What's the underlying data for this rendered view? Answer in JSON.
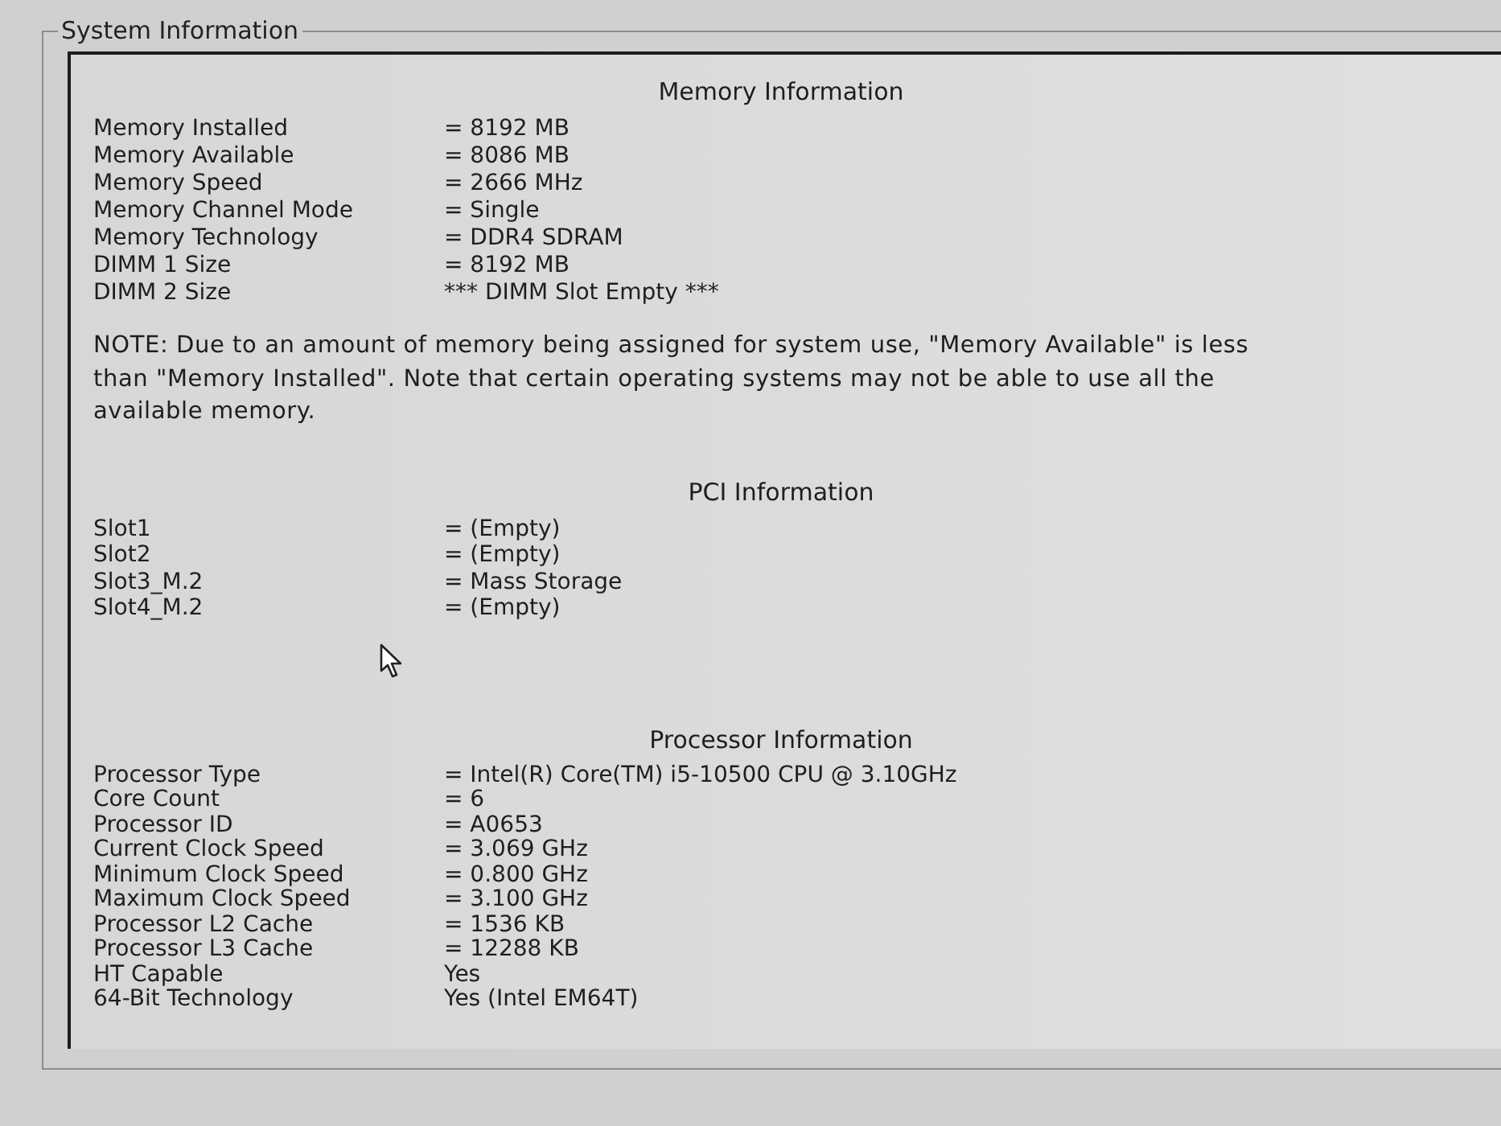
{
  "group_box": {
    "title": "System Information"
  },
  "sections": [
    {
      "heading": "Memory Information",
      "rows": [
        {
          "label": "Memory Installed",
          "value": "= 8192 MB"
        },
        {
          "label": "Memory Available",
          "value": "= 8086 MB"
        },
        {
          "label": "Memory Speed",
          "value": "= 2666 MHz"
        },
        {
          "label": "Memory Channel Mode",
          "value": "= Single"
        },
        {
          "label": "Memory Technology",
          "value": "= DDR4 SDRAM"
        },
        {
          "label": "DIMM 1 Size",
          "value": "= 8192 MB"
        },
        {
          "label": "DIMM 2 Size",
          "value": "*** DIMM Slot Empty ***"
        }
      ],
      "note": "NOTE: Due to an amount of memory being assigned for system use, \"Memory Available\" is less than \"Memory Installed\". Note that certain operating systems may not be able to use all the available memory."
    },
    {
      "heading": "PCI Information",
      "rows": [
        {
          "label": "Slot1",
          "value": "= (Empty)"
        },
        {
          "label": "Slot2",
          "value": "= (Empty)"
        },
        {
          "label": "Slot3_M.2",
          "value": "= Mass Storage"
        },
        {
          "label": "Slot4_M.2",
          "value": "= (Empty)"
        }
      ]
    },
    {
      "heading": "Processor Information",
      "rows": [
        {
          "label": "Processor Type",
          "value": "= Intel(R) Core(TM) i5-10500 CPU @ 3.10GHz"
        },
        {
          "label": "Core Count",
          "value": "= 6"
        },
        {
          "label": "Processor ID",
          "value": "= A0653"
        },
        {
          "label": "Current Clock Speed",
          "value": "= 3.069 GHz"
        },
        {
          "label": "Minimum Clock Speed",
          "value": "= 0.800 GHz"
        },
        {
          "label": "Maximum Clock Speed",
          "value": "= 3.100 GHz"
        },
        {
          "label": "Processor L2 Cache",
          "value": "= 1536 KB"
        },
        {
          "label": "Processor L3 Cache",
          "value": "= 12288 KB"
        },
        {
          "label": "HT Capable",
          "value": "Yes"
        },
        {
          "label": "64-Bit Technology",
          "value": "Yes (Intel EM64T)"
        }
      ]
    }
  ]
}
